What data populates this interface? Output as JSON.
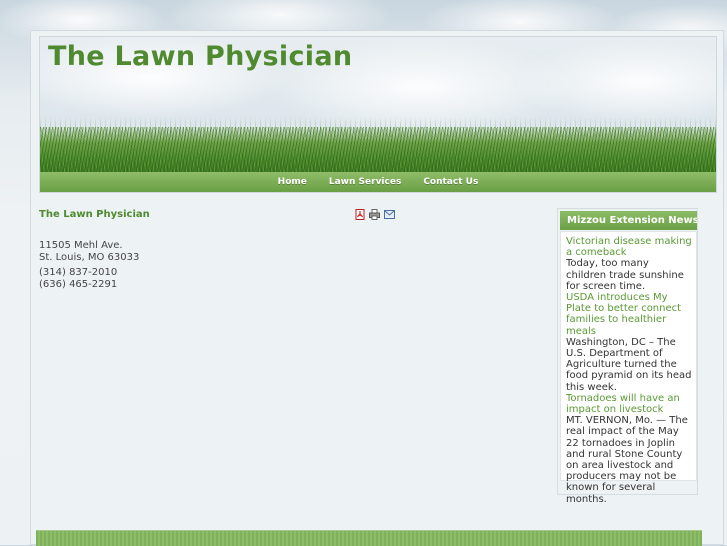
{
  "site": {
    "title": "The Lawn Physician"
  },
  "nav": {
    "items": [
      {
        "label": "Home"
      },
      {
        "label": "Lawn Services"
      },
      {
        "label": "Contact Us"
      }
    ]
  },
  "content": {
    "title": "The Lawn Physician",
    "tools": [
      "pdf-icon",
      "print-icon",
      "email-icon"
    ],
    "address_line1": "11505 Mehl Ave.",
    "address_line2": "St. Louis, MO 63033",
    "phone1": "(314) 837-2010",
    "phone2": "(636) 465-2291"
  },
  "sidebar": {
    "title": "Mizzou Extension News",
    "news": [
      {
        "headline": "Victorian disease making a comeback",
        "summary": " Today, too many children trade sunshine for screen time."
      },
      {
        "headline": "USDA introduces My Plate to better connect families to healthier meals",
        "summary": "Washington, DC – The U.S. Department of Agriculture turned the food pyramid on its head this week."
      },
      {
        "headline": "Tornadoes will have an impact on livestock",
        "summary": "MT. VERNON, Mo. — The real impact of the May 22 tornadoes in Joplin and rural Stone County on area livestock and producers may not be known for several months."
      }
    ]
  },
  "colors": {
    "brand_green": "#4f8a2f",
    "link_green": "#5a9a34",
    "nav_green": "#6a9f45"
  }
}
